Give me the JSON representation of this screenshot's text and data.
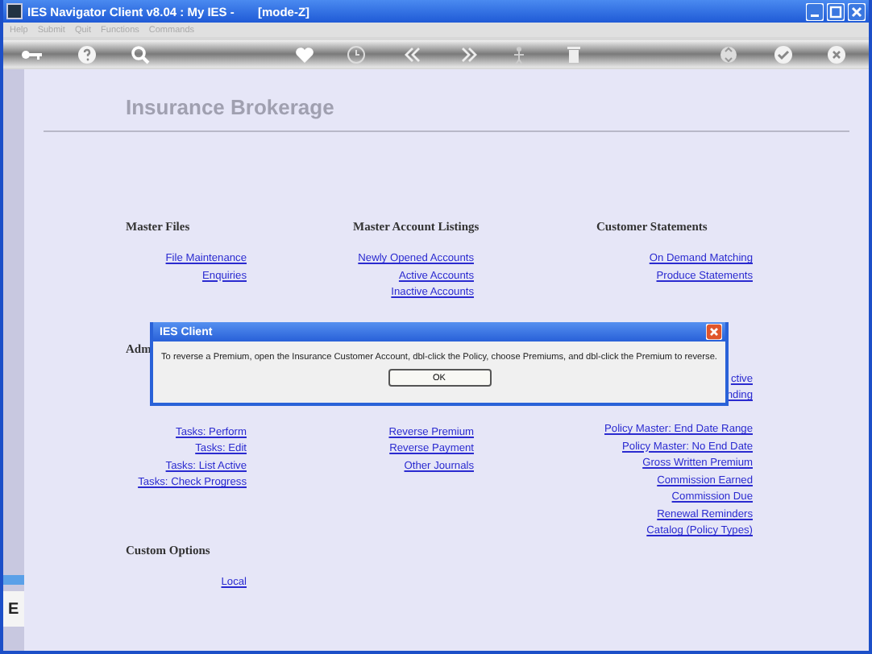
{
  "window": {
    "title": "IES Navigator Client v8.04 : My IES -       [mode-Z]"
  },
  "menu": [
    "Help",
    "Submit",
    "Quit",
    "Functions",
    "Commands"
  ],
  "page_title": "Insurance Brokerage",
  "sections": [
    {
      "columns": [
        {
          "heading": "Master Files",
          "links": [
            "File Maintenance",
            "Enquiries"
          ]
        },
        {
          "heading": "Master Account Listings",
          "links": [
            "Newly Opened Accounts",
            "Active Accounts",
            "Inactive Accounts"
          ]
        },
        {
          "heading": "Customer Statements",
          "links": [
            "On Demand Matching",
            "Produce Statements"
          ]
        }
      ]
    },
    {
      "columns": [
        {
          "heading": "Adm",
          "links": [
            "Tasks: Perform",
            "Tasks: Edit",
            "Tasks: List Active",
            "Tasks: Check Progress"
          ]
        },
        {
          "links": [
            "Reverse Premium",
            "Reverse Payment",
            "Other Journals"
          ]
        },
        {
          "links": [
            "ctive",
            "nding",
            "Policy Master: End Date Range",
            "Policy Master: No End Date",
            "Gross Written Premium",
            "Commission Earned",
            "Commission Due",
            "Renewal Reminders",
            "Catalog (Policy Types)"
          ]
        }
      ]
    },
    {
      "columns": [
        {
          "heading": "Custom Options",
          "links": [
            "Local"
          ]
        }
      ]
    }
  ],
  "dialog": {
    "title": "IES Client",
    "message": "To reverse a Premium, open the Insurance Customer Account, dbl-click the Policy, choose Premiums, and dbl-click the Premium to reverse.",
    "button": "OK"
  },
  "background_window": {
    "text": "E"
  }
}
